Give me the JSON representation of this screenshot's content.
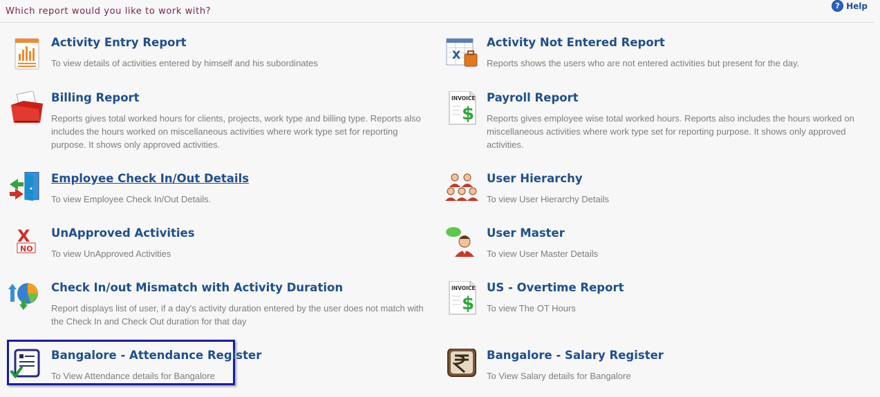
{
  "header": {
    "title": "Which report would you like to work with?",
    "help_label": "Help"
  },
  "reports": [
    {
      "title": "Activity Entry Report",
      "desc": "To view details of activities entered by himself and his subordinates"
    },
    {
      "title": "Activity Not Entered Report",
      "desc": "Reports shows the users who are not entered activities but present for the day."
    },
    {
      "title": "Billing Report",
      "desc": "Reports gives total worked hours for clients, projects, work type and billing type. Reports also includes the hours worked on miscellaneous activities where work type set for reporting purpose. It shows only approved activities."
    },
    {
      "title": "Payroll Report",
      "desc": "Reports gives employee wise total worked hours. Reports also includes the hours worked on miscellaneous activities where work type set for reporting purpose. It shows only approved activities."
    },
    {
      "title": "Employee Check In/Out Details",
      "desc": "To view Employee Check In/Out Details."
    },
    {
      "title": "User Hierarchy",
      "desc": "To view User Hierarchy Details"
    },
    {
      "title": "UnApproved Activities",
      "desc": "To view UnApproved Activities"
    },
    {
      "title": "User Master",
      "desc": "To view User Master Details"
    },
    {
      "title": "Check In/out Mismatch with Activity Duration",
      "desc": "Report displays list of user, if a day's activity duration entered by the user does not match with the Check In and Check Out duration for that day"
    },
    {
      "title": "US - Overtime Report",
      "desc": "To view The OT Hours"
    },
    {
      "title": "Bangalore - Attendance Register",
      "desc": "To View Attendance details for Bangalore"
    },
    {
      "title": "Bangalore - Salary Register",
      "desc": "To View Salary details for Bangalore"
    }
  ],
  "icon_labels": {
    "invoice": "INVOICE",
    "no": "NO"
  },
  "colors": {
    "title": "#1f4f8f",
    "header_title": "#7a1f4d",
    "selection_border": "#1a1aa8"
  }
}
